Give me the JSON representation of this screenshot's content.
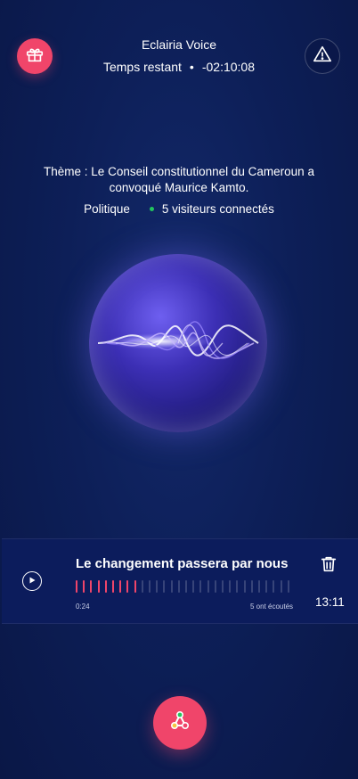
{
  "header": {
    "app_title": "Eclairia Voice",
    "timer_label": "Temps restant",
    "timer_separator": "•",
    "timer_value": "-02:10:08"
  },
  "icons": {
    "gift": "gift-icon",
    "alert": "alert-triangle-icon",
    "play": "play-icon",
    "trash": "trash-icon",
    "record": "share-network-icon"
  },
  "theme": {
    "text": "Thème : Le Conseil constitutionnel du Cameroun a convoqué Maurice Kamto.",
    "category": "Politique",
    "visitors": "5 visiteurs connectés"
  },
  "track": {
    "title": "Le changement passera par nous",
    "position": "0:24",
    "listens": "5 ont écoutés",
    "duration": "13:11",
    "played_bars": 9,
    "total_bars": 30
  },
  "colors": {
    "accent": "#f0456a",
    "online": "#22c55e",
    "background": "#0d1f58"
  }
}
